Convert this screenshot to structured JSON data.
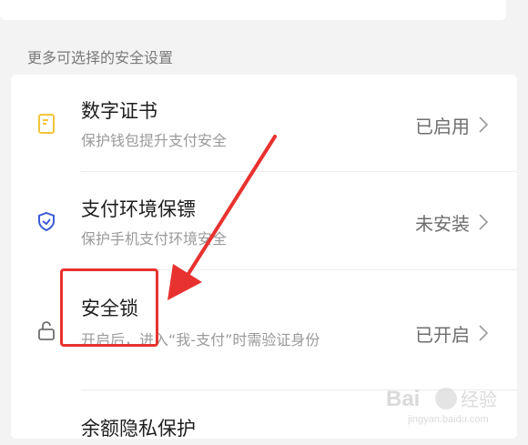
{
  "section": {
    "label": "更多可选择的安全设置"
  },
  "items": [
    {
      "title": "数字证书",
      "subtitle": "保护钱包提升支付安全",
      "status": "已启用",
      "icon": "certificate-icon"
    },
    {
      "title": "支付环境保镖",
      "subtitle": "保护手机支付环境安全",
      "status": "未安装",
      "icon": "shield-icon"
    },
    {
      "title": "安全锁",
      "subtitle": "开启后，进入“我-支付”时需验证身份",
      "status": "已开启",
      "icon": "lock-icon"
    },
    {
      "title": "余额隐私保护",
      "subtitle": "",
      "status": "",
      "icon": ""
    }
  ],
  "colors": {
    "certificate": "#f3c53a",
    "shield": "#3a5bd9",
    "lock": "#6e6e6e",
    "highlight": "#e8322f"
  },
  "watermark": {
    "brand": "Bai",
    "brand_cn": "经验",
    "url": "jingyan.baidu.com"
  }
}
